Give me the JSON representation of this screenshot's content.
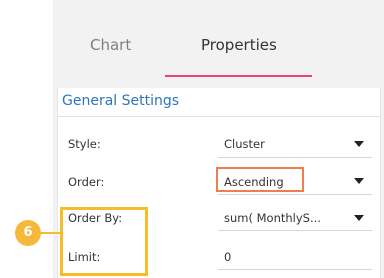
{
  "tabs": {
    "chart": "Chart",
    "properties": "Properties"
  },
  "section": {
    "title": "General Settings"
  },
  "rows": [
    {
      "label": "Style:",
      "value": "Cluster"
    },
    {
      "label": "Order:",
      "value": "Ascending"
    },
    {
      "label": "Order By:",
      "value": "sum( MonthlyS..."
    },
    {
      "label": "Limit:",
      "value": "0"
    }
  ],
  "callout": {
    "step": "6"
  },
  "colors": {
    "accent_tab": "#e0457b",
    "section_title": "#2e75b6",
    "highlight_orange": "#ef7d4f",
    "highlight_yellow": "#f4bd2a",
    "badge": "#f4b93a"
  }
}
